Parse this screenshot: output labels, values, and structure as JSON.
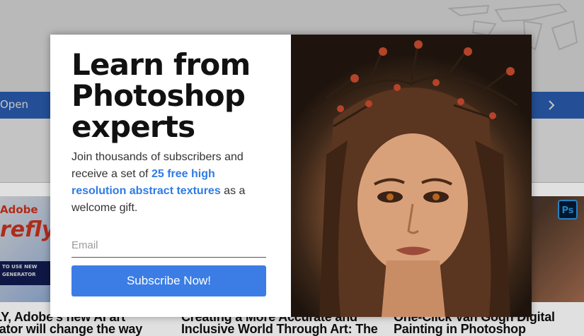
{
  "page": {
    "top_bar_text": "Open"
  },
  "cards": [
    {
      "image_logo": "Adobe",
      "image_big": "refly",
      "image_tag": "TO USE NEW GENERATOR",
      "title": "LY, Adobe's new AI art rator will change the way"
    },
    {
      "title": "Creating a More Accurate and Inclusive World Through Art: The"
    },
    {
      "badge": "Ps",
      "title": "One-Click Van Gogh Digital Painting in Photoshop"
    }
  ],
  "popup": {
    "headline_lines": [
      "Learn from",
      "Photoshop",
      "experts"
    ],
    "body_before": "Join thousands of subscribers and receive a set of ",
    "body_highlight": "25 free high resolution abstract textures",
    "body_after": " as a welcome gift.",
    "email_placeholder": "Email",
    "email_value": "",
    "subscribe_label": "Subscribe Now!"
  },
  "colors": {
    "accent_blue": "#3b7de5",
    "highlight_text": "#2f7be6",
    "nav_bar_blue": "#2f67c2",
    "photoshop_badge": "#31a8ff"
  },
  "icons": {
    "nav_next": "chevron-right-icon",
    "badge": "photoshop-icon",
    "decoration": "pen-sketch-icon"
  }
}
